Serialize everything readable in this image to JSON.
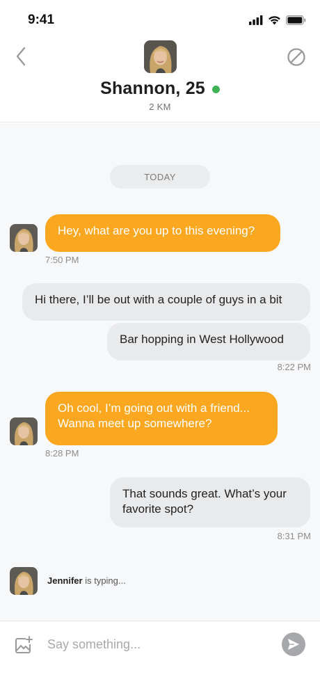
{
  "status_bar": {
    "time": "9:41"
  },
  "header": {
    "name": "Shannon, 25",
    "distance": "2 KM",
    "online": true
  },
  "chat": {
    "date_label": "TODAY",
    "messages": [
      {
        "side": "in",
        "text": "Hey, what are you up to this evening?",
        "time": "7:50 PM"
      },
      {
        "side": "out",
        "text": "Hi there, I’ll be out with a couple of guys in a bit"
      },
      {
        "side": "out",
        "text": "Bar hopping in West Hollywood",
        "time": "8:22 PM"
      },
      {
        "side": "in",
        "lines": [
          "Oh cool, I’m going out with a friend...",
          "Wanna meet up somewhere?"
        ],
        "time": "8:28 PM"
      },
      {
        "side": "out",
        "lines": [
          "That sounds great. What’s your",
          "favorite spot?"
        ],
        "time": "8:31 PM"
      }
    ],
    "typing": {
      "name": "Jennifer",
      "text": "is typing..."
    }
  },
  "composer": {
    "placeholder": "Say something..."
  },
  "colors": {
    "incoming_bubble": "#fba71f",
    "outgoing_bubble": "#e9eaec",
    "online": "#3eb255",
    "send_button": "#a6a8ab"
  },
  "icons": [
    "back-chevron-icon",
    "block-icon",
    "add-image-icon",
    "send-icon",
    "signal-icon",
    "wifi-icon",
    "battery-icon"
  ]
}
